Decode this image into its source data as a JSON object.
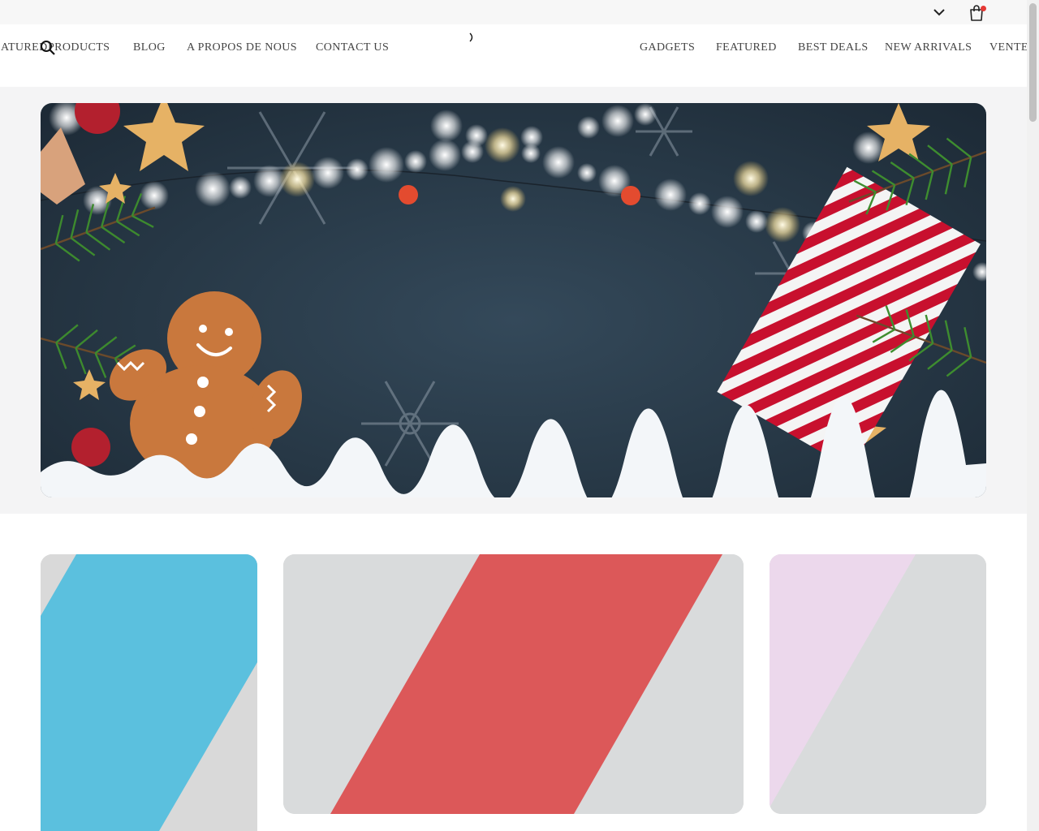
{
  "topbar": {
    "dropdown_icon": "chevron-down-icon",
    "cart_icon": "shopping-bag-icon",
    "cart_badge_color": "#e53935"
  },
  "nav": {
    "left_items": [
      "ATURED",
      "PRODUCTS",
      "BLOG",
      "A PROPOS DE NOUS",
      "CONTACT US"
    ],
    "right_items": [
      "GADGETS",
      "FEATURED",
      "BEST DEALS",
      "NEW ARRIVALS",
      "VENTES"
    ],
    "search_icon": "search-icon"
  },
  "hero": {
    "image": "christmas-banner-gingerbread-lights-gift",
    "background_color": "#273846"
  },
  "cards": [
    {
      "accent_color": "#5bc0de",
      "image": "product-placeholder-blue-stripe"
    },
    {
      "accent_color": "#dc5859",
      "image": "product-placeholder-red-stripe"
    },
    {
      "accent_color": "#ecd8ec",
      "image": "product-placeholder-lavender-stripe"
    }
  ],
  "colors": {
    "page_bg": "#ffffff",
    "band_bg": "#f4f4f5",
    "nav_text": "#444444"
  }
}
